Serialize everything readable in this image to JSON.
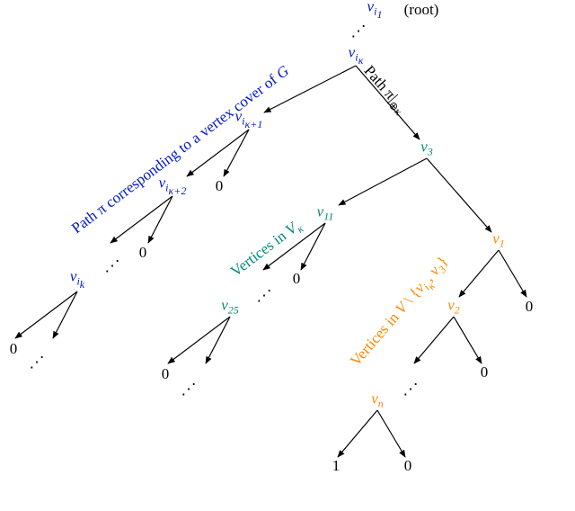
{
  "root_suffix": "(root)",
  "v": {
    "i1": "v<sub class='sub it'>i<sub class='sub'>1</sub></sub>",
    "ik": "v<sub class='sub it'>i<sub class='sub'>κ</sub></sub>",
    "ik1": "v<sub class='sub it'>i<sub class='sub'>κ+1</sub></sub>",
    "ik2": "v<sub class='sub it'>i<sub class='sub'>κ+2</sub></sub>",
    "ikk": "v<sub class='sub it'>i<sub class='sub'>k</sub></sub>",
    "v3": "v<sub class='sub'>3</sub>",
    "v11": "v<sub class='sub'>11</sub>",
    "v25": "v<sub class='sub'>25</sub>",
    "v1": "v<sub class='sub'>1</sub>",
    "v2": "v<sub class='sub'>2</sub>",
    "vn": "v<sub class='sub it'>n</sub>"
  },
  "zero": "0",
  "one": "1",
  "labels": {
    "blue_path": "Path π corresponding to a vertex cover of <span class='it'>G</span>",
    "right_path": "Path π|<sub class='sub'>⊕κ</sub>",
    "teal": "Vertices in <span class='it'>V<sub class='sub'>κ</sub></span>",
    "orange": "Vertices in <span class='it'>V</span> \\ {<span class='it'>v<sub class='sub'>i<sub class='sub'>κ</sub></sub></span>, <span class='it'>v<sub class='sub'>3</sub></span>}"
  }
}
